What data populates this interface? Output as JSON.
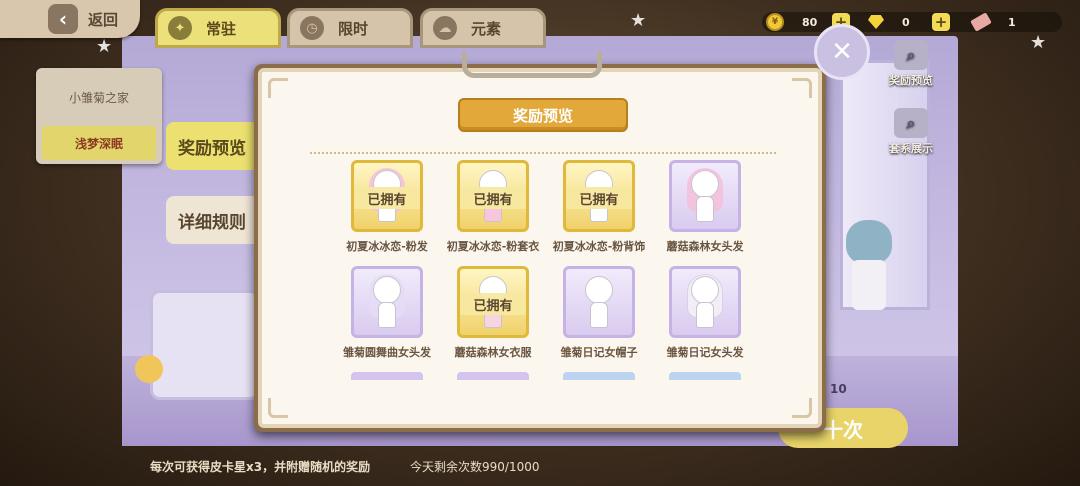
{
  "header": {
    "back_label": "返回",
    "tabs": [
      {
        "label": "常驻",
        "active": true,
        "icon": "star-hand-icon"
      },
      {
        "label": "限时",
        "active": false,
        "icon": "clock-icon"
      },
      {
        "label": "元素",
        "active": false,
        "icon": "cloud-icon"
      }
    ]
  },
  "currency": {
    "coins": "80",
    "gems": "0",
    "tickets": "1"
  },
  "side_menu": {
    "items": [
      {
        "label": "小雏菊之家",
        "active": false
      },
      {
        "label": "浅梦深眠",
        "active": true
      }
    ]
  },
  "side_tabs": {
    "preview": "奖励预览",
    "rules": "详细规则"
  },
  "right_tools": {
    "reward_preview": "奖励预览",
    "set_display": "套系展示"
  },
  "modal": {
    "title": "奖励预览",
    "owned_label": "已拥有",
    "items": [
      {
        "name": "初夏冰冰恋-粉发",
        "owned": true,
        "frame": "gold"
      },
      {
        "name": "初夏冰冰恋-粉套衣",
        "owned": true,
        "frame": "gold"
      },
      {
        "name": "初夏冰冰恋-粉背饰",
        "owned": true,
        "frame": "gold"
      },
      {
        "name": "蘑菇森林女头发",
        "owned": false,
        "frame": "purple"
      },
      {
        "name": "雏菊圆舞曲女头发",
        "owned": false,
        "frame": "purple"
      },
      {
        "name": "蘑菇森林女衣服",
        "owned": true,
        "frame": "gold"
      },
      {
        "name": "雏菊日记女帽子",
        "owned": false,
        "frame": "purple"
      },
      {
        "name": "雏菊日记女头发",
        "owned": false,
        "frame": "purple"
      }
    ]
  },
  "draw": {
    "button_label": "十次",
    "count": "10"
  },
  "footer": {
    "description": "每次可获得皮卡星x3，并附赠随机的奖励",
    "remaining": "今天剩余次数990/1000"
  },
  "colors": {
    "accent_yellow": "#ebe070",
    "frame_gold": "#e0b83b",
    "frame_purple": "#c7b2e6",
    "ribbon": "#e2a93a"
  }
}
